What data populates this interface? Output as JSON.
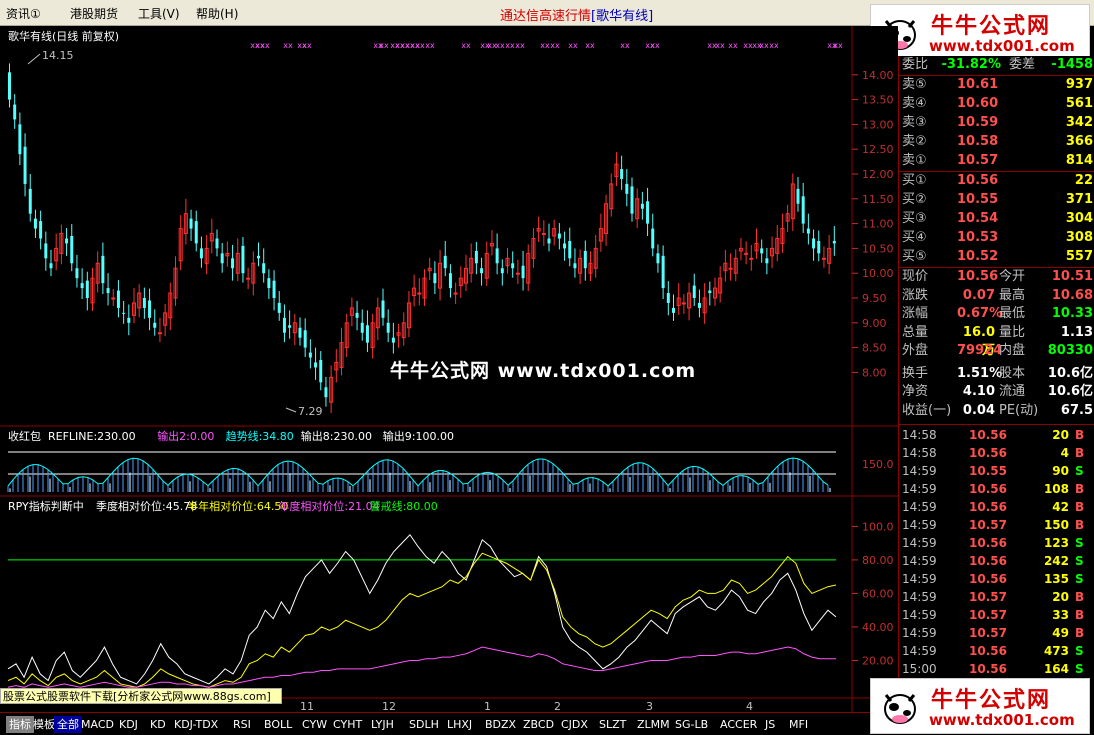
{
  "menu": {
    "items": [
      "资讯①",
      "港股期货",
      "工具(V)",
      "帮助(H)"
    ]
  },
  "title": {
    "prefix": "通达信高速行情",
    "suffix": "[歌华有线]"
  },
  "logo": {
    "name": "牛牛公式网",
    "url": "www.tdx001.com"
  },
  "watermark": "牛牛公式网 www.tdx001.com",
  "chart_data": [
    {
      "type": "candlestick",
      "title": "歌华有线(日线 前复权)",
      "y_ticks": [
        "14.00",
        "13.50",
        "13.00",
        "12.50",
        "12.00",
        "11.50",
        "11.00",
        "10.50",
        "10.00",
        "9.50",
        "9.00",
        "8.50",
        "8.00"
      ],
      "ylim": [
        7.0,
        14.5
      ],
      "max_label": "14.15",
      "min_label": "7.29",
      "close": [
        13.5,
        13.1,
        12.4,
        11.8,
        11.2,
        10.9,
        10.7,
        10.3,
        10.1,
        10.5,
        10.8,
        10.6,
        10.2,
        9.9,
        9.7,
        9.5,
        9.9,
        10.2,
        9.8,
        9.6,
        9.5,
        9.3,
        9.2,
        9.0,
        9.4,
        9.6,
        9.3,
        9.1,
        8.9,
        8.8,
        9.2,
        9.6,
        10.1,
        10.9,
        11.2,
        10.9,
        10.6,
        10.3,
        10.5,
        10.8,
        10.5,
        10.2,
        10.4,
        10.1,
        10.4,
        10.0,
        9.9,
        10.2,
        10.3,
        10.0,
        9.7,
        9.5,
        9.2,
        8.8,
        8.9,
        9.0,
        8.7,
        8.5,
        8.3,
        8.1,
        7.8,
        7.5,
        7.9,
        8.2,
        8.6,
        9.0,
        9.3,
        9.1,
        8.8,
        8.6,
        9.0,
        9.3,
        9.1,
        8.8,
        8.6,
        8.8,
        9.0,
        9.4,
        9.7,
        9.6,
        9.9,
        10.1,
        9.8,
        10.2,
        10.1,
        9.7,
        9.6,
        9.9,
        10.1,
        10.3,
        10.2,
        10.0,
        10.4,
        10.6,
        10.2,
        10.0,
        10.3,
        10.1,
        10.0,
        9.9,
        10.4,
        10.7,
        10.9,
        10.8,
        10.6,
        10.9,
        10.7,
        10.5,
        10.3,
        10.1,
        10.3,
        10.1,
        10.2,
        10.5,
        10.9,
        11.4,
        11.8,
        12.2,
        11.9,
        11.6,
        11.2,
        11.5,
        11.3,
        11.0,
        10.5,
        10.2,
        9.7,
        9.4,
        9.2,
        9.5,
        9.4,
        9.6,
        9.5,
        9.3,
        9.5,
        9.6,
        9.7,
        9.9,
        10.2,
        10.1,
        10.3,
        10.5,
        10.4,
        10.3,
        10.6,
        10.4,
        10.2,
        10.5,
        10.7,
        10.9,
        11.2,
        11.8,
        11.4,
        11.0,
        10.8,
        10.5,
        10.4,
        10.3,
        10.5,
        10.6
      ],
      "signals": "xx"
    },
    {
      "type": "bar",
      "title": "收红包",
      "header": [
        {
          "text": "REFLINE:230.00",
          "color": "#ffffff"
        },
        {
          "text": "输出2:0.00",
          "color": "#ff55ff"
        },
        {
          "text": "趋势线:34.80",
          "color": "#00ffff"
        },
        {
          "text": "输出8:230.00",
          "color": "#ffffff"
        },
        {
          "text": "输出9:100.00",
          "color": "#ffffff"
        }
      ],
      "y_ticks": [
        "150.0"
      ]
    },
    {
      "type": "line",
      "title": "RPY指标判断中",
      "header": [
        {
          "text": "季度相对价位:45.78",
          "color": "#ffffff"
        },
        {
          "text": "半年相对价位:64.50",
          "color": "#ffff00"
        },
        {
          "text": "年度相对价位:21.04",
          "color": "#ff55ff"
        },
        {
          "text": "警戒线:80.00",
          "color": "#00ff00"
        }
      ],
      "y_ticks": [
        "100.0",
        "80.00",
        "60.00",
        "40.00",
        "20.00"
      ],
      "ylim": [
        0,
        105
      ],
      "series": [
        {
          "name": "季度相对价位",
          "color": "#ffffff",
          "values": [
            15,
            18,
            10,
            22,
            12,
            8,
            20,
            25,
            14,
            10,
            15,
            20,
            28,
            18,
            10,
            8,
            6,
            12,
            20,
            30,
            22,
            18,
            12,
            10,
            8,
            6,
            10,
            15,
            12,
            20,
            35,
            40,
            50,
            45,
            55,
            48,
            60,
            70,
            75,
            80,
            72,
            78,
            85,
            80,
            70,
            60,
            68,
            78,
            85,
            90,
            95,
            88,
            82,
            78,
            85,
            80,
            72,
            68,
            80,
            92,
            88,
            80,
            75,
            70,
            72,
            68,
            82,
            76,
            60,
            40,
            32,
            28,
            25,
            20,
            15,
            18,
            22,
            28,
            32,
            38,
            44,
            40,
            36,
            48,
            52,
            55,
            58,
            52,
            50,
            55,
            62,
            58,
            50,
            48,
            55,
            60,
            68,
            72,
            62,
            48,
            38,
            44,
            50,
            46
          ]
        },
        {
          "name": "半年相对价位",
          "color": "#ffff00",
          "values": [
            8,
            10,
            6,
            12,
            8,
            5,
            10,
            12,
            8,
            6,
            8,
            10,
            14,
            10,
            6,
            5,
            4,
            6,
            10,
            15,
            12,
            10,
            8,
            6,
            5,
            4,
            6,
            8,
            7,
            10,
            18,
            20,
            24,
            22,
            28,
            25,
            30,
            35,
            36,
            40,
            38,
            40,
            44,
            42,
            40,
            38,
            40,
            44,
            50,
            56,
            60,
            58,
            60,
            62,
            64,
            68,
            66,
            70,
            78,
            84,
            82,
            80,
            78,
            75,
            72,
            68,
            80,
            74,
            62,
            46,
            40,
            36,
            34,
            30,
            28,
            30,
            34,
            38,
            42,
            46,
            50,
            48,
            45,
            52,
            56,
            58,
            62,
            60,
            60,
            62,
            68,
            66,
            60,
            62,
            66,
            70,
            76,
            82,
            78,
            66,
            60,
            62,
            64,
            65
          ]
        },
        {
          "name": "年度相对价位",
          "color": "#ff55ff",
          "values": [
            4,
            5,
            4,
            6,
            5,
            4,
            5,
            6,
            5,
            4,
            5,
            6,
            7,
            6,
            5,
            4,
            4,
            5,
            6,
            7,
            7,
            6,
            6,
            5,
            5,
            4,
            5,
            6,
            6,
            7,
            8,
            9,
            10,
            10,
            11,
            11,
            12,
            13,
            13,
            14,
            14,
            15,
            15,
            15,
            15,
            15,
            16,
            17,
            18,
            19,
            20,
            20,
            21,
            21,
            22,
            22,
            23,
            24,
            26,
            28,
            27,
            26,
            25,
            24,
            23,
            22,
            24,
            23,
            21,
            18,
            17,
            16,
            15,
            14,
            14,
            15,
            16,
            17,
            18,
            19,
            20,
            20,
            20,
            21,
            22,
            22,
            23,
            23,
            23,
            24,
            25,
            25,
            24,
            24,
            25,
            26,
            27,
            28,
            27,
            24,
            22,
            21,
            21,
            21
          ]
        }
      ],
      "alert_line": 80
    }
  ],
  "x_labels": [
    "11",
    "12",
    "1",
    "2",
    "3",
    "4"
  ],
  "quote": {
    "header": {
      "wb_label": "委比",
      "wb_value": "-31.82%",
      "wc_label": "委差",
      "wc_value": "-1458"
    },
    "sell": [
      {
        "label": "卖⑤",
        "price": "10.61",
        "vol": "937"
      },
      {
        "label": "卖④",
        "price": "10.60",
        "vol": "561"
      },
      {
        "label": "卖③",
        "price": "10.59",
        "vol": "342"
      },
      {
        "label": "卖②",
        "price": "10.58",
        "vol": "366"
      },
      {
        "label": "卖①",
        "price": "10.57",
        "vol": "814"
      }
    ],
    "buy": [
      {
        "label": "买①",
        "price": "10.56",
        "vol": "22"
      },
      {
        "label": "买②",
        "price": "10.55",
        "vol": "371"
      },
      {
        "label": "买③",
        "price": "10.54",
        "vol": "304"
      },
      {
        "label": "买④",
        "price": "10.53",
        "vol": "308"
      },
      {
        "label": "买⑤",
        "price": "10.52",
        "vol": "557"
      }
    ],
    "stats": [
      {
        "l1": "现价",
        "v1": "10.56",
        "c1": "#ff5050",
        "l2": "今开",
        "v2": "10.51",
        "c2": "#ff5050"
      },
      {
        "l1": "涨跌",
        "v1": "0.07",
        "c1": "#ff5050",
        "l2": "最高",
        "v2": "10.68",
        "c2": "#ff5050"
      },
      {
        "l1": "涨幅",
        "v1": "0.67%",
        "c1": "#ff5050",
        "l2": "最低",
        "v2": "10.33",
        "c2": "#00ff00"
      },
      {
        "l1": "总量",
        "v1": "16.0万",
        "c1": "#ffff00",
        "l2": "量比",
        "v2": "1.13",
        "c2": "#ffffff"
      },
      {
        "l1": "外盘",
        "v1": "79924",
        "c1": "#ff5050",
        "l2": "内盘",
        "v2": "80330",
        "c2": "#00ff00"
      },
      {
        "l1": "换手",
        "v1": "1.51%",
        "c1": "#ffffff",
        "l2": "股本",
        "v2": "10.6亿",
        "c2": "#ffffff"
      },
      {
        "l1": "净资",
        "v1": "4.10",
        "c1": "#ffffff",
        "l2": "流通",
        "v2": "10.6亿",
        "c2": "#ffffff"
      },
      {
        "l1": "收益(一)",
        "v1": "0.04",
        "c1": "#ffffff",
        "l2": "PE(动)",
        "v2": "67.5",
        "c2": "#ffffff"
      }
    ],
    "ticks": [
      {
        "t": "14:58",
        "p": "10.56",
        "v": "20",
        "f": "B"
      },
      {
        "t": "14:58",
        "p": "10.56",
        "v": "4",
        "f": "B"
      },
      {
        "t": "14:59",
        "p": "10.55",
        "v": "90",
        "f": "S"
      },
      {
        "t": "14:59",
        "p": "10.56",
        "v": "108",
        "f": "B"
      },
      {
        "t": "14:59",
        "p": "10.56",
        "v": "42",
        "f": "B"
      },
      {
        "t": "14:59",
        "p": "10.57",
        "v": "150",
        "f": "B"
      },
      {
        "t": "14:59",
        "p": "10.56",
        "v": "123",
        "f": "S"
      },
      {
        "t": "14:59",
        "p": "10.56",
        "v": "242",
        "f": "S"
      },
      {
        "t": "14:59",
        "p": "10.56",
        "v": "135",
        "f": "S"
      },
      {
        "t": "14:59",
        "p": "10.57",
        "v": "20",
        "f": "B"
      },
      {
        "t": "14:59",
        "p": "10.57",
        "v": "33",
        "f": "B"
      },
      {
        "t": "14:59",
        "p": "10.57",
        "v": "49",
        "f": "B"
      },
      {
        "t": "14:59",
        "p": "10.56",
        "v": "473",
        "f": "S"
      },
      {
        "t": "15:00",
        "p": "10.56",
        "v": "164",
        "f": "S"
      }
    ]
  },
  "adbar": "股票公式股票软件下载[分析家公式网www.88gs.com]",
  "tabs": [
    "指标",
    "模板",
    "全部",
    "MACD",
    "KDJ",
    "KD",
    "KDJ-TDX",
    "RSI",
    "BOLL",
    "CYW",
    "CYHT",
    "LYJH",
    "SDLH",
    "LHXJ",
    "BDZX",
    "ZBCD",
    "CJDX",
    "SLZT",
    "ZLMM",
    "SG-LB",
    "ACCER",
    "JS",
    "MFI"
  ],
  "colors": {
    "up": "#ff3030",
    "down": "#54ffff",
    "grid": "#8b0000",
    "axis": "#c03030"
  }
}
